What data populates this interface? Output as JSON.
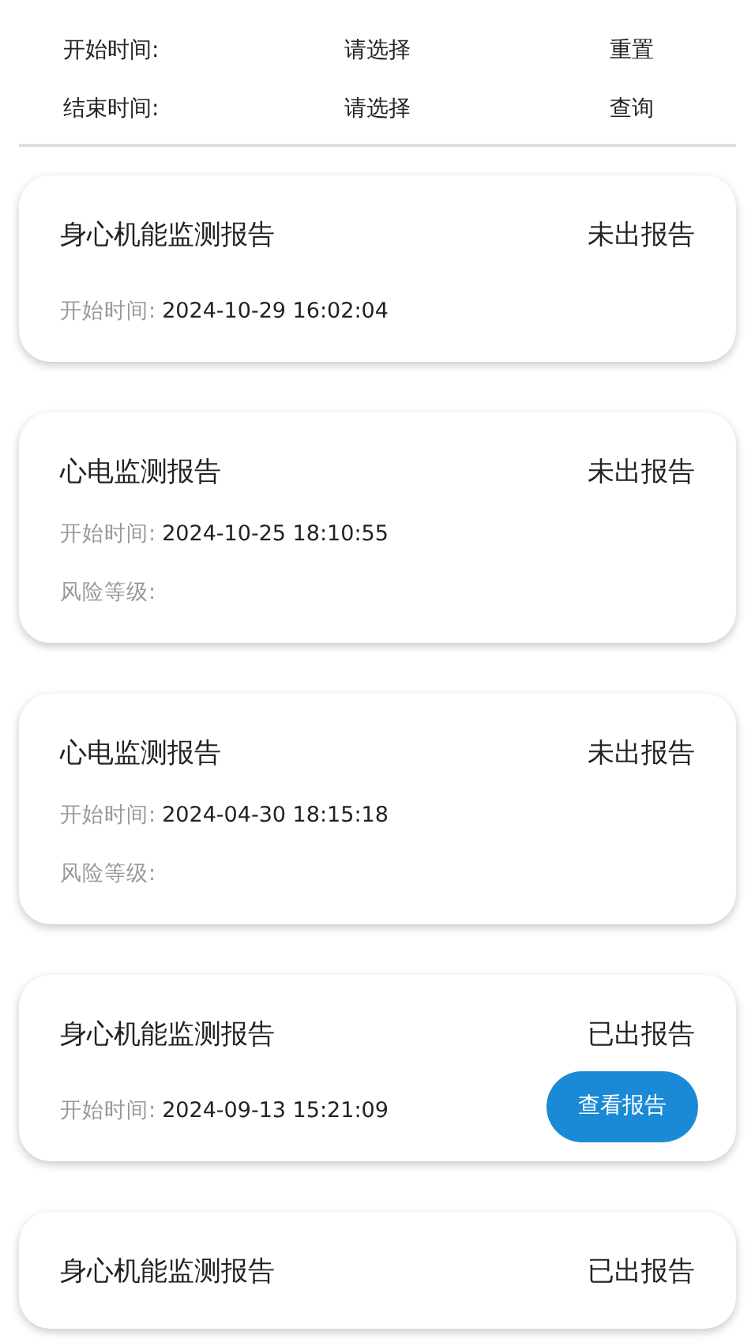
{
  "filter": {
    "rows": [
      {
        "label": "开始时间:",
        "value": "请选择",
        "action": "重置"
      },
      {
        "label": "结束时间:",
        "value": "请选择",
        "action": "查询"
      }
    ]
  },
  "reports": [
    {
      "title": "身心机能监测报告",
      "status": "未出报告",
      "start_label": "开始时间:",
      "start_time": "2024-10-29 16:02:04"
    },
    {
      "title": "心电监测报告",
      "status": "未出报告",
      "start_label": "开始时间:",
      "start_time": "2024-10-25 18:10:55",
      "risk_label": "风险等级:"
    },
    {
      "title": "心电监测报告",
      "status": "未出报告",
      "start_label": "开始时间:",
      "start_time": "2024-04-30 18:15:18",
      "risk_label": "风险等级:"
    },
    {
      "title": "身心机能监测报告",
      "status": "已出报告",
      "start_label": "开始时间:",
      "start_time": "2024-09-13 15:21:09",
      "button": "查看报告"
    },
    {
      "title": "身心机能监测报告",
      "status": "已出报告"
    }
  ]
}
